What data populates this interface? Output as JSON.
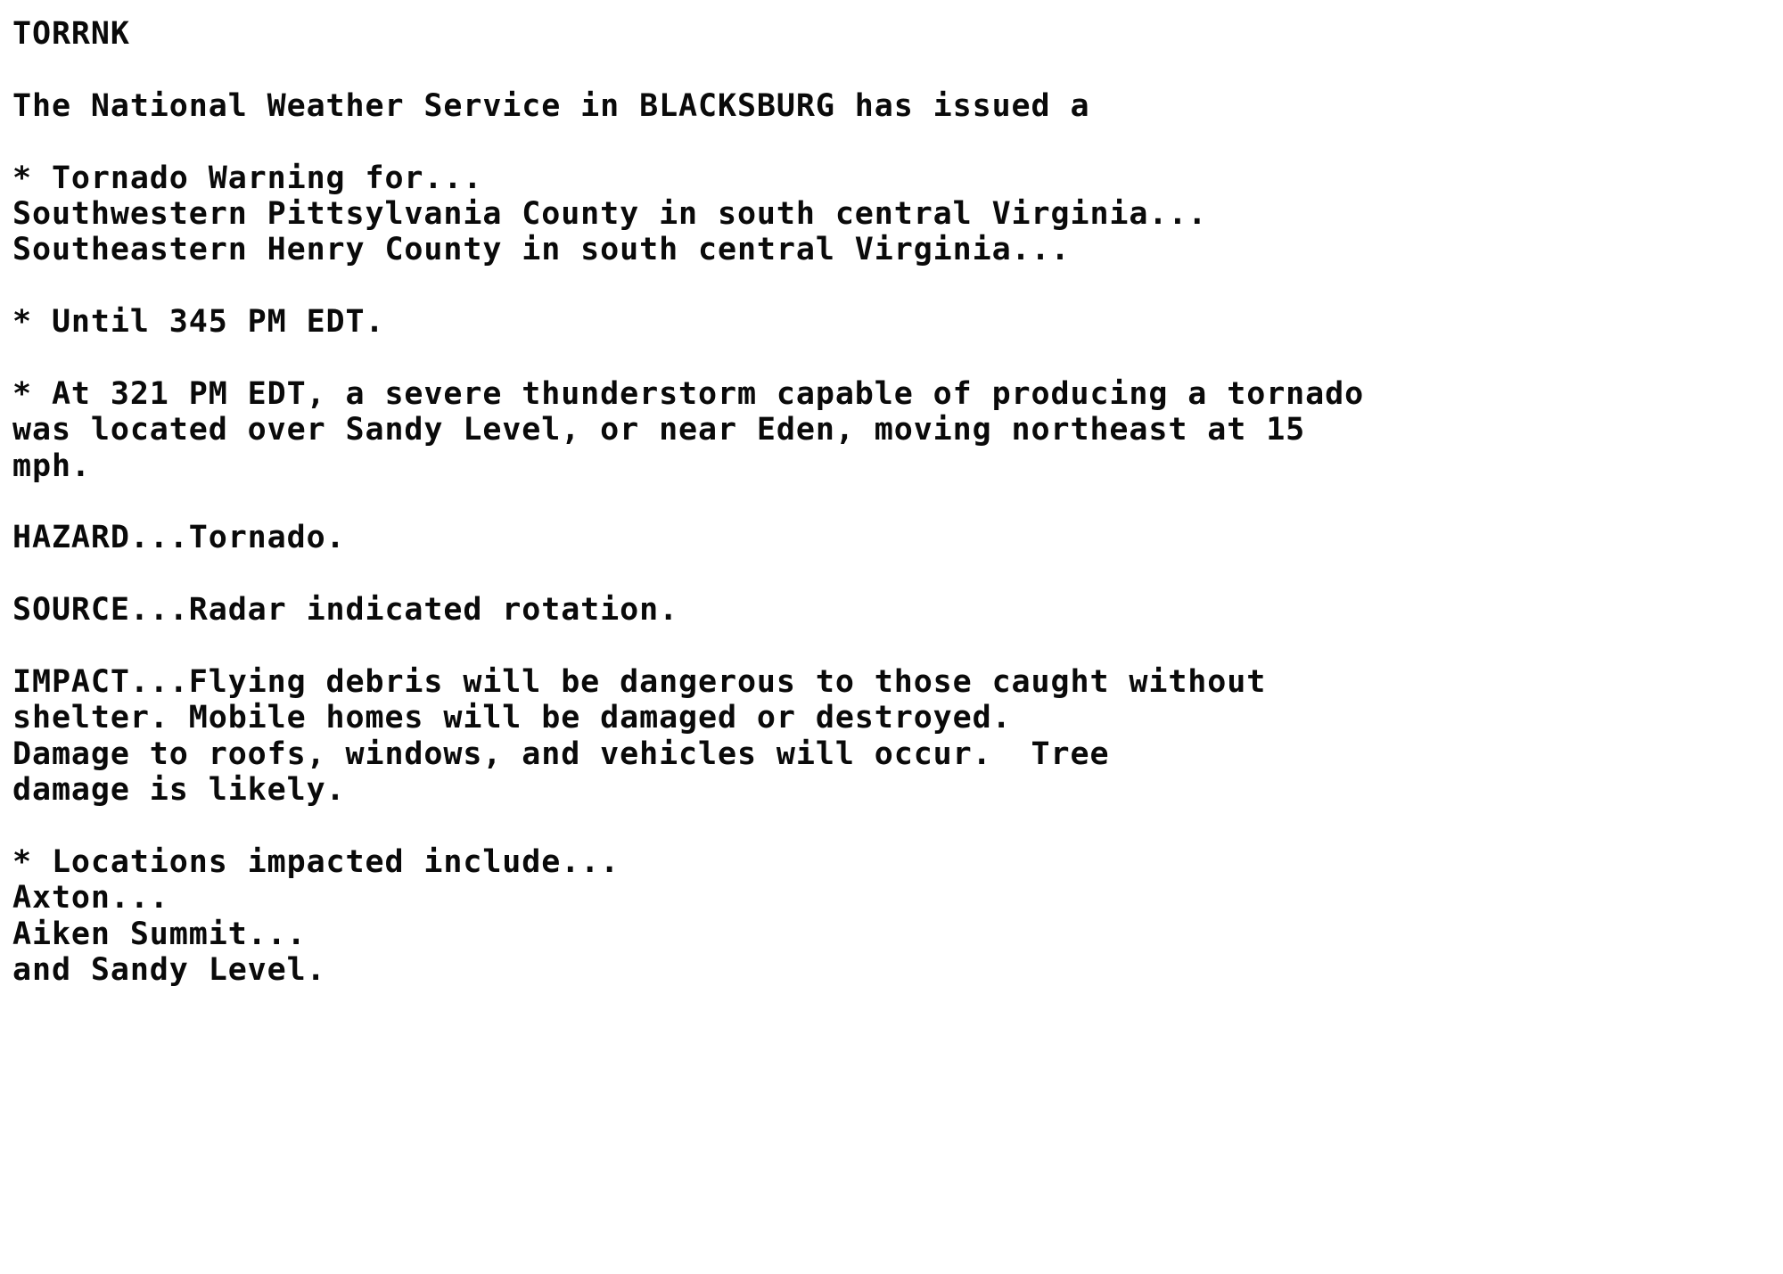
{
  "document": {
    "kind": "nws-text-bulletin",
    "product_code": "TORRNK",
    "text_color": "#0a0a0a",
    "background_color": "#ffffff",
    "lines": [
      "TORRNK",
      "",
      "The National Weather Service in BLACKSBURG has issued a",
      "",
      "* Tornado Warning for...",
      "Southwestern Pittsylvania County in south central Virginia...",
      "Southeastern Henry County in south central Virginia...",
      "",
      "* Until 345 PM EDT.",
      "",
      "* At 321 PM EDT, a severe thunderstorm capable of producing a tornado",
      "was located over Sandy Level, or near Eden, moving northeast at 15",
      "mph.",
      "",
      "HAZARD...Tornado.",
      "",
      "SOURCE...Radar indicated rotation.",
      "",
      "IMPACT...Flying debris will be dangerous to those caught without",
      "shelter. Mobile homes will be damaged or destroyed.",
      "Damage to roofs, windows, and vehicles will occur.  Tree",
      "damage is likely.",
      "",
      "* Locations impacted include...",
      "Axton...",
      "Aiken Summit...",
      "and Sandy Level."
    ],
    "details": {
      "issuing_office": "BLACKSBURG",
      "warning_type": "Tornado Warning",
      "expires": "345 PM EDT",
      "observed_time": "321 PM EDT",
      "storm_location": "Sandy Level",
      "near_location": "Eden",
      "movement_direction": "northeast",
      "movement_speed": "15 mph",
      "hazard": "Tornado.",
      "source": "Radar indicated rotation.",
      "counties": [
        "Southwestern Pittsylvania County in south central Virginia...",
        "Southeastern Henry County in south central Virginia..."
      ],
      "locations_impacted": [
        "Axton...",
        "Aiken Summit...",
        "and Sandy Level."
      ]
    }
  }
}
